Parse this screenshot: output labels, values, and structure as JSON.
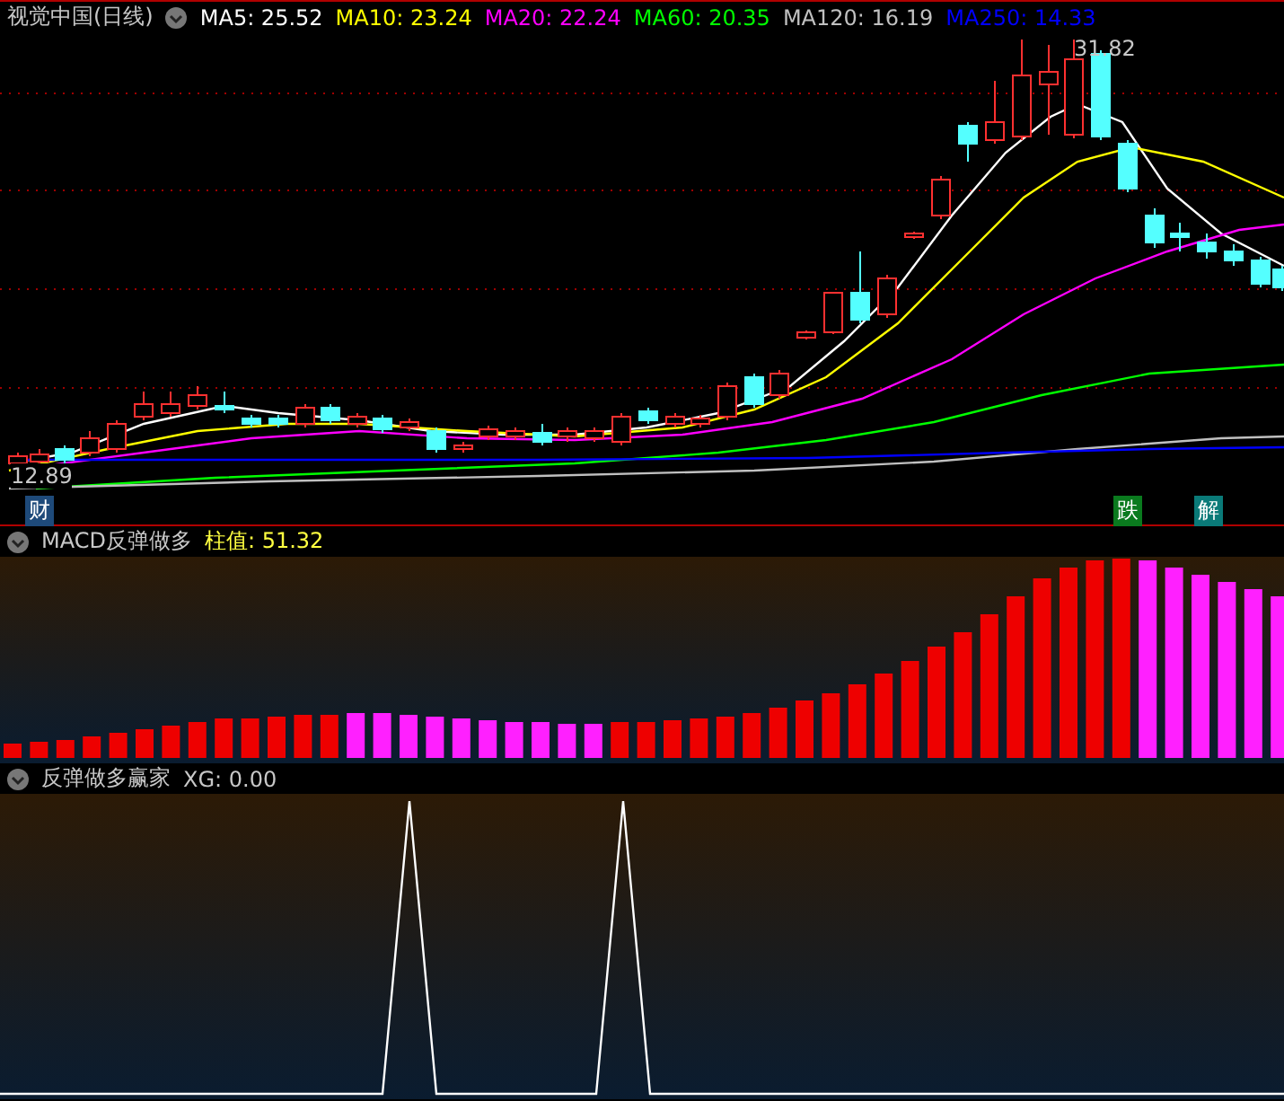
{
  "header": {
    "title": "视觉中国(日线)",
    "indicators": [
      {
        "label": "MA5: 25.52",
        "color": "#ffffff"
      },
      {
        "label": "MA10: 23.24",
        "color": "#ffff00"
      },
      {
        "label": "MA20: 22.24",
        "color": "#ff00ff"
      },
      {
        "label": "MA60: 20.35",
        "color": "#00ff00"
      },
      {
        "label": "MA120: 16.19",
        "color": "#c0c0c0"
      },
      {
        "label": "MA250: 14.33",
        "color": "#0000ff"
      }
    ]
  },
  "price_panel": {
    "high_label": "31.82",
    "low_label": "12.89",
    "markers": [
      {
        "text": "财",
        "color": "#1e4a7a"
      },
      {
        "text": "跌",
        "color": "#0a7a1e"
      },
      {
        "text": "解",
        "color": "#0a7a78"
      }
    ]
  },
  "macd_panel": {
    "title": "MACD反弹做多",
    "value": "柱值: 51.32"
  },
  "signal_panel": {
    "title": "反弹做多赢家",
    "value": "XG: 0.00"
  }
}
